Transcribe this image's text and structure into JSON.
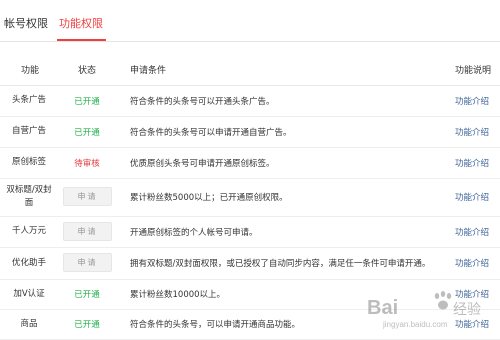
{
  "tabs": {
    "account": "帐号权限",
    "features": "功能权限"
  },
  "table": {
    "headers": {
      "func": "功能",
      "status": "状态",
      "condition": "申请条件",
      "note": "功能说明"
    },
    "rows": [
      {
        "func": "头条广告",
        "status": "已开通",
        "status_type": "open",
        "condition": "符合条件的头条号可以开通头条广告。",
        "link": "功能介绍"
      },
      {
        "func": "自营广告",
        "status": "已开通",
        "status_type": "open",
        "condition": "符合条件的头条号可以申请开通自营广告。",
        "link": "功能介绍"
      },
      {
        "func": "原创标签",
        "status": "待审核",
        "status_type": "pending",
        "condition": "优质原创头条号可申请开通原创标签。",
        "link": "功能介绍"
      },
      {
        "func": "双标题/双封面",
        "status": "申请",
        "status_type": "apply",
        "condition": "累计粉丝数5000以上；已开通原创权限。",
        "link": "功能介绍"
      },
      {
        "func": "千人万元",
        "status": "申请",
        "status_type": "apply",
        "condition": "开通原创标签的个人帐号可申请。",
        "link": "功能介绍"
      },
      {
        "func": "优化助手",
        "status": "申请",
        "status_type": "apply",
        "condition": "拥有双标题/双封面权限，或已授权了自动同步内容，满足任一条件可申请开通。",
        "link": "功能介绍"
      },
      {
        "func": "加V认证",
        "status": "已开通",
        "status_type": "open",
        "condition": "累计粉丝数10000以上。",
        "link": "功能介绍"
      },
      {
        "func": "商品",
        "status": "已开通",
        "status_type": "open",
        "condition": "符合条件的头条号，可以申请开通商品功能。",
        "link": "功能介绍"
      }
    ]
  },
  "watermark": {
    "text": "Bai度经验",
    "url": "jingyan.baidu.com"
  },
  "colors": {
    "accent": "#f04142",
    "open": "#24b24a",
    "pending": "#e4393c",
    "link": "#406599"
  }
}
